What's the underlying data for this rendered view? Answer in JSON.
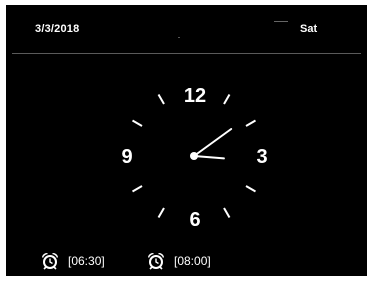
{
  "header": {
    "date": "3/3/2018",
    "day": "Sat"
  },
  "clock": {
    "numerals": {
      "twelve": "12",
      "three": "3",
      "six": "6",
      "nine": "9"
    },
    "time": {
      "hour": 3,
      "minute": 9
    }
  },
  "alarms": [
    {
      "time": "[06:30]",
      "icon": "alarm-clock-icon"
    },
    {
      "time": "[08:00]",
      "icon": "alarm-clock-icon"
    }
  ],
  "colors": {
    "background": "#000000",
    "foreground": "#ffffff"
  }
}
